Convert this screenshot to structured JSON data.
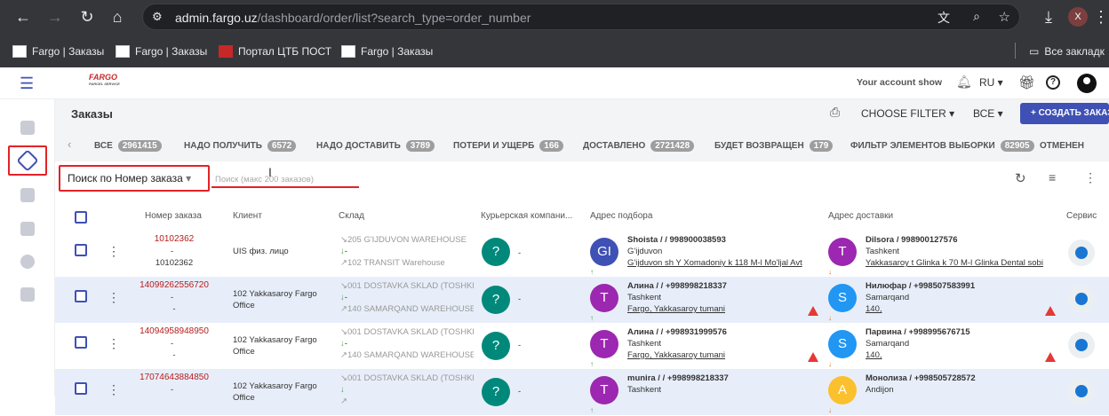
{
  "browser": {
    "url_domain": "admin.fargo.uz",
    "url_path": "/dashboard/order/list?search_type=order_number",
    "profile_initial": "X",
    "bookmarks": [
      "Fargo | Заказы",
      "Fargo | Заказы",
      "Портал ЦТБ ПОСТ",
      "Fargo | Заказы"
    ],
    "all_bookmarks": "Все закладк"
  },
  "app": {
    "logo": "FARGO",
    "logo_sub": "PARCEL SERVICE",
    "account": "Your account show",
    "lang": "RU",
    "page_title": "Заказы",
    "choose_filter": "CHOOSE FILTER",
    "all_label": "ВСЕ",
    "create_button": "+ СОЗДАТЬ ЗАКАЗ"
  },
  "tabs": [
    {
      "label": "ВСЕ",
      "count": "2961415"
    },
    {
      "label": "НАДО ПОЛУЧИТЬ",
      "count": "6572"
    },
    {
      "label": "НАДО ДОСТАВИТЬ",
      "count": "3789"
    },
    {
      "label": "ПОТЕРИ И УЩЕРБ",
      "count": "166"
    },
    {
      "label": "ДОСТАВЛЕНО",
      "count": "2721428"
    },
    {
      "label": "БУДЕТ ВОЗВРАЩЕН",
      "count": "179"
    },
    {
      "label": "ФИЛЬТР ЭЛЕМЕНТОВ ВЫБОРКИ",
      "count": "82905"
    },
    {
      "label": "ОТМЕНЕН",
      "count": ""
    }
  ],
  "search": {
    "type_label": "Поиск по Номер заказа",
    "placeholder": "Поиск (макс 200 заказов)"
  },
  "columns": [
    "Номер заказа",
    "Клиент",
    "Склад",
    "Курьерская компани...",
    "Адрес подбора",
    "Адрес доставки",
    "Сервис"
  ],
  "rows": [
    {
      "order": "10102362",
      "dash": "-",
      "order2": "10102362",
      "client": "UIS физ. лицо",
      "client2": "",
      "wh_from": "205 G'IJDUVON WAREHOUSE",
      "wh_mid": "-",
      "wh_to": "102 TRANSIT Warehouse",
      "courier": "-",
      "pick_initial": "GI",
      "pick_color": "#3f51b5",
      "pick_name": "Shoista / / 998900038593",
      "pick_city": "G'ijduvon",
      "pick_addr": "G'ijduvon sh Y Xomadoniy k 118 M-l Mo'ljal Avt",
      "del_initial": "T",
      "del_color": "#9c27b0",
      "del_name": "Dilsora / 998900127576",
      "del_city": "Tashkent",
      "del_addr": "Yakkasaroy t Glinka k 70 M-l Glinka Dental sobi"
    },
    {
      "order": "14099262556720",
      "dash": "-",
      "order2": "-",
      "client": "102 Yakkasaroy Fargo",
      "client2": "Office",
      "wh_from": "001 DOSTAVKA SKLAD (TOSHKE",
      "wh_mid": "-",
      "wh_to": "140 SAMARQAND WAREHOUSE",
      "courier": "-",
      "pick_initial": "T",
      "pick_color": "#9c27b0",
      "pick_name": "Алина / / +998998218337",
      "pick_city": "Tashkent",
      "pick_addr": "Fargo, Yakkasaroy tumani",
      "del_initial": "S",
      "del_color": "#2196f3",
      "del_name": "Нилюфар / +998507583991",
      "del_city": "Samarqand",
      "del_addr": "140,"
    },
    {
      "order": "14094958948950",
      "dash": "-",
      "order2": "-",
      "client": "102 Yakkasaroy Fargo",
      "client2": "Office",
      "wh_from": "001 DOSTAVKA SKLAD (TOSHKE",
      "wh_mid": "-",
      "wh_to": "140 SAMARQAND WAREHOUSE",
      "courier": "-",
      "pick_initial": "T",
      "pick_color": "#9c27b0",
      "pick_name": "Алина / / +998931999576",
      "pick_city": "Tashkent",
      "pick_addr": "Fargo, Yakkasaroy tumani",
      "del_initial": "S",
      "del_color": "#2196f3",
      "del_name": "Парвина / +998995676715",
      "del_city": "Samarqand",
      "del_addr": "140,"
    },
    {
      "order": "17074643884850",
      "dash": "-",
      "order2": "",
      "client": "102 Yakkasaroy Fargo",
      "client2": "Office",
      "wh_from": "001 DOSTAVKA SKLAD (TOSHKE",
      "wh_mid": "",
      "wh_to": "",
      "courier": "-",
      "pick_initial": "T",
      "pick_color": "#9c27b0",
      "pick_name": "munira / / +998998218337",
      "pick_city": "Tashkent",
      "pick_addr": "",
      "del_initial": "A",
      "del_color": "#fbc02d",
      "del_name": "Монолиза / +998505728572",
      "del_city": "Andijon",
      "del_addr": ""
    }
  ],
  "courier_initial": "?"
}
